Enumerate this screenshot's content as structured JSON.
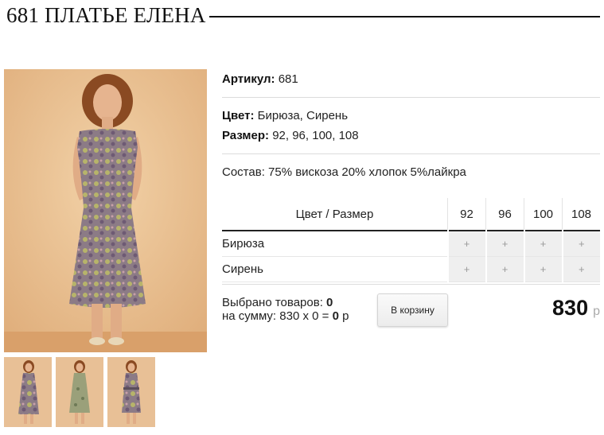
{
  "product": {
    "title": "681 ПЛАТЬЕ ЕЛЕНА",
    "article_label": "Артикул:",
    "article_value": "681",
    "color_label": "Цвет:",
    "color_value": "Бирюза, Сирень",
    "size_label": "Размер:",
    "size_value": "92, 96, 100, 108",
    "composition": "Состав: 75% вискоза 20% хлопок 5%лайкра"
  },
  "grid": {
    "header_label": "Цвет / Размер",
    "sizes": [
      "92",
      "96",
      "100",
      "108"
    ],
    "rows": [
      {
        "color": "Бирюза",
        "cells": [
          "+",
          "+",
          "+",
          "+"
        ]
      },
      {
        "color": "Сирень",
        "cells": [
          "+",
          "+",
          "+",
          "+"
        ]
      }
    ]
  },
  "summary": {
    "selected_label": "Выбрано товаров:",
    "selected_count": "0",
    "sum_label": "на сумму: 830 х 0 =",
    "sum_value": "0",
    "sum_currency": "р"
  },
  "cart_button_label": "В корзину",
  "price": {
    "value": "830",
    "currency": "р"
  },
  "colors": {
    "background_beige": "#eec79c",
    "dress_mauve": "#8f7a86",
    "dress_green": "#b5b36a"
  }
}
